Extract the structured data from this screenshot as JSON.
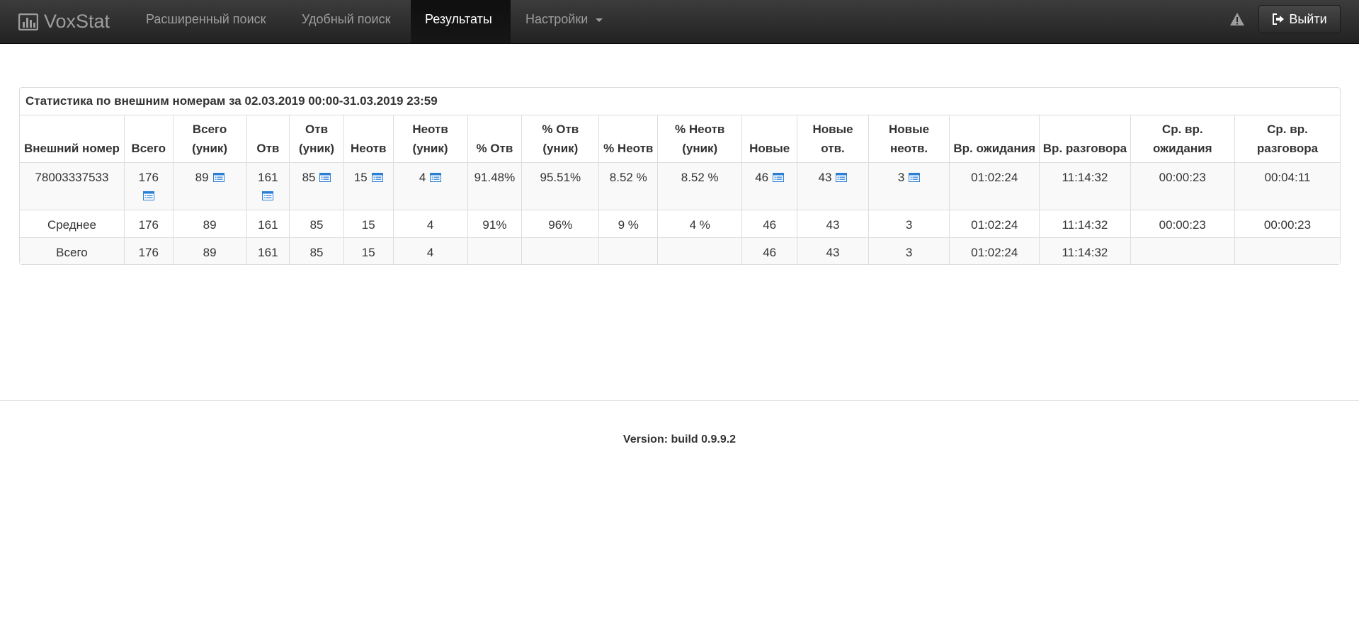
{
  "navbar": {
    "brand": "VoxStat",
    "items": [
      {
        "label": "Расширенный поиск"
      },
      {
        "label": "Удобный поиск"
      },
      {
        "label": "Результаты"
      },
      {
        "label": "Настройки"
      }
    ],
    "logout_label": "Выйти"
  },
  "panel": {
    "title": "Статистика по внешним номерам за 02.03.2019 00:00-31.03.2019 23:59"
  },
  "table": {
    "headers": [
      "Внешний номер",
      "Всего",
      "Всего (уник)",
      "Отв",
      "Отв (уник)",
      "Неотв",
      "Неотв (уник)",
      "% Отв",
      "% Отв (уник)",
      "% Неотв",
      "% Неотв (уник)",
      "Новые",
      "Новые отв.",
      "Новые неотв.",
      "Вр. ожидания",
      "Вр. разговора",
      "Ср. вр. ожидания",
      "Ср. вр. разговора"
    ],
    "rows": [
      [
        "78003337533",
        "176",
        "89",
        "161",
        "85",
        "15",
        "4",
        "91.48%",
        "95.51%",
        "8.52 %",
        "8.52 %",
        "46",
        "43",
        "3",
        "01:02:24",
        "11:14:32",
        "00:00:23",
        "00:04:11"
      ],
      [
        "Среднее",
        "176",
        "89",
        "161",
        "85",
        "15",
        "4",
        "91%",
        "96%",
        "9 %",
        "4 %",
        "46",
        "43",
        "3",
        "01:02:24",
        "11:14:32",
        "00:00:23",
        "00:00:23"
      ],
      [
        "Всего",
        "176",
        "89",
        "161",
        "85",
        "15",
        "4",
        "",
        "",
        "",
        "",
        "46",
        "43",
        "3",
        "01:02:24",
        "11:14:32",
        "",
        ""
      ]
    ]
  },
  "footer": {
    "version": "Version: build 0.9.9.2"
  },
  "colors": {
    "navbar_bg": "#222222",
    "nav_text": "#9d9d9d",
    "list_icon": "#2a7fd4",
    "table_stripe": "#f9f9f9"
  },
  "icons": {
    "brand": "bar-chart-icon",
    "warning": "warning-icon",
    "logout": "sign-out-icon",
    "detail": "list-icon"
  }
}
